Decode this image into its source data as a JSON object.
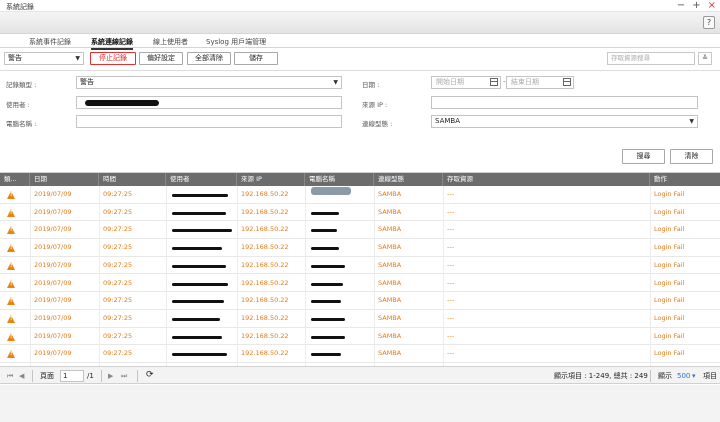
{
  "window": {
    "title": "系統記錄",
    "controls": [
      "−",
      "+",
      "×"
    ]
  },
  "help_label": "?",
  "tabs": [
    {
      "label": "系統事件記錄",
      "active": false
    },
    {
      "label": "系統連線記錄",
      "active": true
    },
    {
      "label": "線上使用者",
      "active": false
    },
    {
      "label": "Syslog 用戶端管理",
      "active": false
    }
  ],
  "toolbar": {
    "level_select": "警告",
    "stop_label": "停止記錄",
    "prefs_label": "偏好設定",
    "clear_all_label": "全部清除",
    "save_label": "儲存",
    "search_placeholder": "存取資源搜尋"
  },
  "filters": {
    "log_type_label": "記錄類型 :",
    "log_type_value": "警告",
    "date_label": "日期 :",
    "start_date_placeholder": "開始日期",
    "end_date_placeholder": "結束日期",
    "user_label": "使用者 :",
    "source_ip_label": "來源 IP :",
    "computer_label": "電腦名稱 :",
    "conn_type_label": "連線型態 :",
    "conn_type_value": "SAMBA",
    "search_btn": "搜尋",
    "clear_btn": "清除"
  },
  "table": {
    "columns": [
      "類...",
      "日期",
      "時間",
      "使用者",
      "來源 IP",
      "電腦名稱",
      "連線型態",
      "存取資源",
      "動作"
    ],
    "rows": [
      {
        "date": "2019/07/09",
        "time": "09:27:25",
        "ip": "192.168.50.22",
        "type": "SAMBA",
        "resource": "---",
        "action": "Login Fail"
      },
      {
        "date": "2019/07/09",
        "time": "09:27:25",
        "ip": "192.168.50.22",
        "type": "SAMBA",
        "resource": "---",
        "action": "Login Fail"
      },
      {
        "date": "2019/07/09",
        "time": "09:27:25",
        "ip": "192.168.50.22",
        "type": "SAMBA",
        "resource": "---",
        "action": "Login Fail"
      },
      {
        "date": "2019/07/09",
        "time": "09:27:25",
        "ip": "192.168.50.22",
        "type": "SAMBA",
        "resource": "---",
        "action": "Login Fail"
      },
      {
        "date": "2019/07/09",
        "time": "09:27:25",
        "ip": "192.168.50.22",
        "type": "SAMBA",
        "resource": "---",
        "action": "Login Fail"
      },
      {
        "date": "2019/07/09",
        "time": "09:27:25",
        "ip": "192.168.50.22",
        "type": "SAMBA",
        "resource": "---",
        "action": "Login Fail"
      },
      {
        "date": "2019/07/09",
        "time": "09:27:25",
        "ip": "192.168.50.22",
        "type": "SAMBA",
        "resource": "---",
        "action": "Login Fail"
      },
      {
        "date": "2019/07/09",
        "time": "09:27:25",
        "ip": "192.168.50.22",
        "type": "SAMBA",
        "resource": "---",
        "action": "Login Fail"
      },
      {
        "date": "2019/07/09",
        "time": "09:27:25",
        "ip": "192.168.50.22",
        "type": "SAMBA",
        "resource": "---",
        "action": "Login Fail"
      },
      {
        "date": "2019/07/09",
        "time": "09:27:25",
        "ip": "192.168.50.22",
        "type": "SAMBA",
        "resource": "---",
        "action": "Login Fail"
      }
    ]
  },
  "pager": {
    "first": "⏮",
    "prev": "◀",
    "page_label": "頁面",
    "page_value": "1",
    "page_total": "/1",
    "next": "▶",
    "last": "⏭",
    "refresh": "⟳",
    "display_info": "顯示項目 : 1-249, 總共 : 249",
    "show_label": "顯示",
    "per_page": "500",
    "per_page_caret": "▾",
    "items_label": "項目"
  },
  "colors": {
    "accent_orange": "#e07b1a",
    "warn_icon": "#e8850c",
    "header_gray": "#6c6c6c",
    "stop_red": "#d33"
  }
}
